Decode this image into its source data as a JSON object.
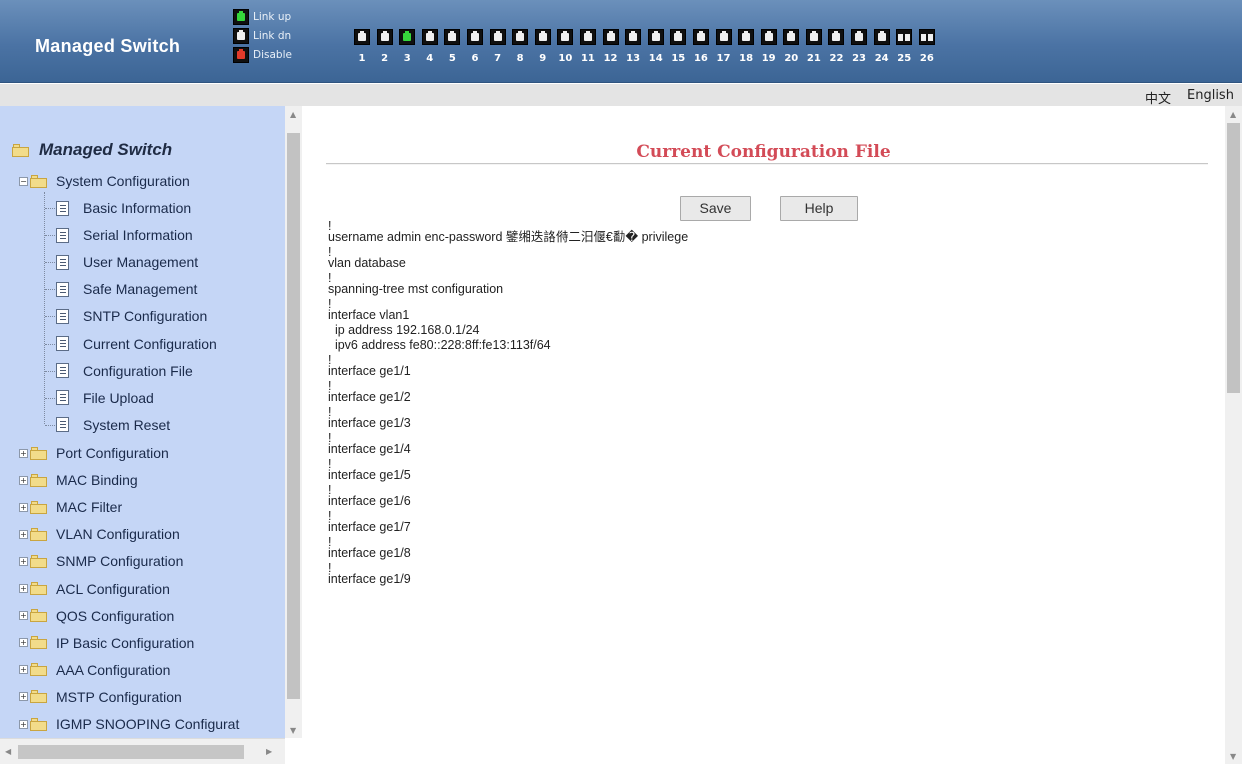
{
  "header": {
    "brand": "Managed Switch",
    "legend": [
      {
        "label": "Link up",
        "state": "up"
      },
      {
        "label": "Link dn",
        "state": "down"
      },
      {
        "label": "Disable",
        "state": "disabled"
      }
    ],
    "ports": [
      {
        "num": "1",
        "state": "down"
      },
      {
        "num": "2",
        "state": "down"
      },
      {
        "num": "3",
        "state": "up"
      },
      {
        "num": "4",
        "state": "down"
      },
      {
        "num": "5",
        "state": "down"
      },
      {
        "num": "6",
        "state": "down"
      },
      {
        "num": "7",
        "state": "down"
      },
      {
        "num": "8",
        "state": "down"
      },
      {
        "num": "9",
        "state": "down"
      },
      {
        "num": "10",
        "state": "down"
      },
      {
        "num": "11",
        "state": "down"
      },
      {
        "num": "12",
        "state": "down"
      },
      {
        "num": "13",
        "state": "down"
      },
      {
        "num": "14",
        "state": "down"
      },
      {
        "num": "15",
        "state": "down"
      },
      {
        "num": "16",
        "state": "down"
      },
      {
        "num": "17",
        "state": "down"
      },
      {
        "num": "18",
        "state": "down"
      },
      {
        "num": "19",
        "state": "down"
      },
      {
        "num": "20",
        "state": "down"
      },
      {
        "num": "21",
        "state": "down"
      },
      {
        "num": "22",
        "state": "down"
      },
      {
        "num": "23",
        "state": "down"
      },
      {
        "num": "24",
        "state": "down"
      },
      {
        "num": "25",
        "state": "fiber"
      },
      {
        "num": "26",
        "state": "fiber"
      }
    ],
    "colors": {
      "link_up": "#36d63b",
      "disable": "#e13a2a",
      "header_bg": "#4b73a4"
    }
  },
  "langbar": {
    "chinese": "中文",
    "english": "English"
  },
  "sidebar": {
    "root": "Managed Switch",
    "system_configuration": "System Configuration",
    "system_items": [
      "Basic Information",
      "Serial Information",
      "User Management",
      "Safe Management",
      "SNTP Configuration",
      "Current Configuration",
      "Configuration File",
      "File Upload",
      "System Reset"
    ],
    "folders": [
      "Port Configuration",
      "MAC Binding",
      "MAC Filter",
      "VLAN Configuration",
      "SNMP Configuration",
      "ACL Configuration",
      "QOS Configuration",
      "IP Basic Configuration",
      "AAA Configuration",
      "MSTP Configuration",
      "IGMP SNOOPING Configurat"
    ]
  },
  "main": {
    "title": "Current Configuration File",
    "save_label": "Save",
    "help_label": "Help",
    "config_lines": [
      "!",
      "username admin enc-password 鐾缃迭詻偫二汨偃€勫� privilege",
      "!",
      "vlan database",
      "!",
      "spanning-tree mst configuration",
      "!",
      "interface vlan1",
      "  ip address 192.168.0.1/24",
      "  ipv6 address fe80::228:8ff:fe13:113f/64",
      "!",
      "interface ge1/1",
      "!",
      "interface ge1/2",
      "!",
      "interface ge1/3",
      "!",
      "interface ge1/4",
      "!",
      "interface ge1/5",
      "!",
      "interface ge1/6",
      "!",
      "interface ge1/7",
      "!",
      "interface ge1/8",
      "!",
      "interface ge1/9"
    ],
    "title_color": "#d34b57"
  }
}
